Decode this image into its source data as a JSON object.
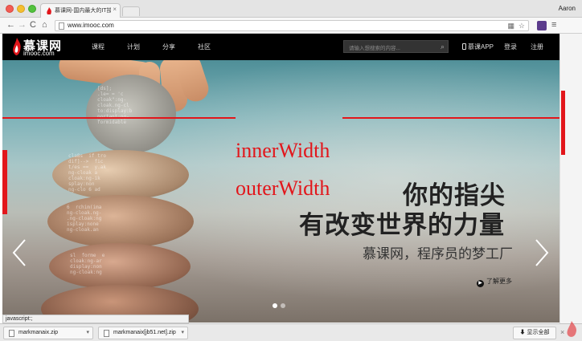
{
  "browser": {
    "tab_title": "慕课网-国内最大的IT技能学",
    "tab_close": "×",
    "profile_name": "Aaron",
    "url": "www.imooc.com",
    "nav": {
      "back": "←",
      "forward": "→",
      "reload": "C",
      "home": "⌂"
    },
    "menu": "≡",
    "grid": "▦",
    "star": "☆"
  },
  "site": {
    "logo_cn": "慕课网",
    "logo_en": "imooc.com",
    "nav_items": [
      "课程",
      "计划",
      "分享",
      "社区"
    ],
    "search_placeholder": "请输入想搜索的内容...",
    "search_icon": "⌕",
    "app_label": "慕课APP",
    "login_label": "登录",
    "register_label": "注册"
  },
  "hero": {
    "inner_label": "innerWidth",
    "outer_label": "outerWidth",
    "slogan_line1": "你的指尖",
    "slogan_line2": "有改变世界的力量",
    "subline": "慕课网，程序员的梦工厂",
    "more_label": "了解更多",
    "more_icon": "▶",
    "code_lines": [
      "[ds];\n.le= = 'c\ncloak\":ng-\ncloak.ng-cl\nto:display:b\nportant;ng-\nformidable",
      "cla8s  if tro\ndif]-->  fic\nt/es ==  y.ak\nng-cloak a\ncloak:ng-ik\nsplay:non\nng-clo 6 ad",
      "6  rchim(ima\nng-cloak.ng-\n.ng-cloak:ng\nisplay:none\nng-cloak.an",
      "sl  forme  e\ncloak:ng-ar\ndisplay:non\nng-cloak:ng"
    ],
    "active_slide": 1,
    "slide_count": 2
  },
  "status_text": "javascript:;",
  "downloads": {
    "items": [
      "markmanaix.zip",
      "markmanaix[jb51.net].zip"
    ],
    "caret": "▾",
    "show_all": "显示全部",
    "close": "×"
  },
  "colors": {
    "accent_red": "#e2161b",
    "header_bg": "#000000"
  }
}
